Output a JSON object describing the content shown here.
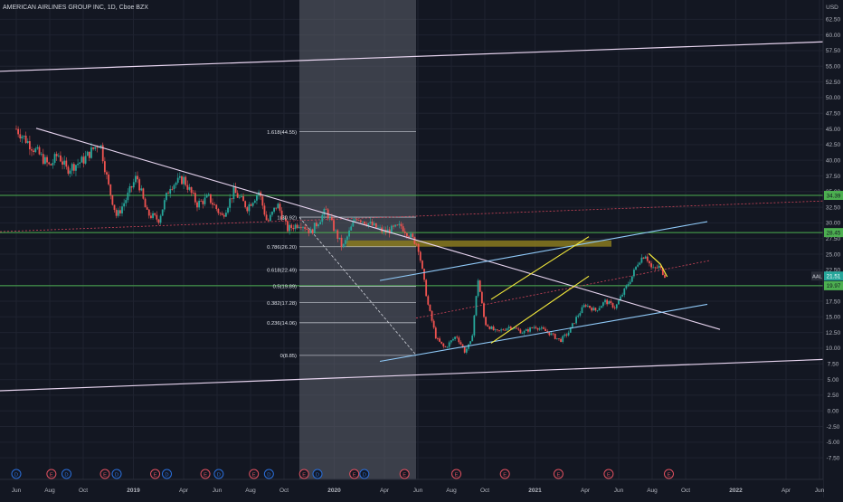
{
  "header": {
    "title": "AMERICAN AIRLINES GROUP INC, 1D, Cboe BZX"
  },
  "colors": {
    "background": "#131722",
    "grid": "#1f2330",
    "axis_text": "#b2b5be",
    "candle_up": "#26a69a",
    "candle_down": "#ef5350",
    "trendline": "#e8d5f0",
    "channel": "#90caf9",
    "wedge": "#f5eb3b",
    "support": "#4caf50",
    "fib_line": "#d1d4dc",
    "zone": "#8a7a1f"
  },
  "chart_data": {
    "type": "candlestick",
    "currency_label": "USD",
    "symbol": "AAL",
    "last_price": 21.51,
    "y_ticks": [
      62.5,
      60.0,
      57.5,
      55.0,
      52.5,
      50.0,
      47.5,
      45.0,
      42.5,
      40.0,
      37.5,
      35.0,
      32.5,
      30.0,
      27.5,
      25.0,
      22.5,
      20.0,
      17.5,
      15.0,
      12.5,
      10.0,
      7.5,
      5.0,
      2.5,
      0.0,
      -2.5,
      -5.0,
      -7.5
    ],
    "ylim": [
      -9.5,
      65
    ],
    "x_ticks": [
      "Jun",
      "Aug",
      "Oct",
      "2019",
      "Apr",
      "Jun",
      "Aug",
      "Oct",
      "2020",
      "Apr",
      "Jun",
      "Aug",
      "Oct",
      "2021",
      "Apr",
      "Jun",
      "Aug",
      "Oct",
      "2022",
      "Apr",
      "Jun"
    ],
    "price_badges": [
      {
        "label": "34.39",
        "value": 34.39
      },
      {
        "label": "28.45",
        "value": 28.45
      },
      {
        "label": "19.97",
        "value": 19.97
      }
    ],
    "fib_levels": [
      {
        "label": "1.618(44.55)",
        "value": 44.55
      },
      {
        "label": "1(30.92)",
        "value": 30.92
      },
      {
        "label": "0.786(26.20)",
        "value": 26.2
      },
      {
        "label": "0.618(22.49)",
        "value": 22.49
      },
      {
        "label": "0.5(19.89)",
        "value": 19.89
      },
      {
        "label": "0.382(17.28)",
        "value": 17.28
      },
      {
        "label": "0.236(14.06)",
        "value": 14.06
      },
      {
        "label": "0(8.85)",
        "value": 8.85
      }
    ],
    "support_levels": [
      34.39,
      28.45,
      19.97
    ],
    "resistance_zone": [
      26.2,
      27.2
    ],
    "events": [
      {
        "month": 0.0,
        "type": "D"
      },
      {
        "month": 2.1,
        "type": "E"
      },
      {
        "month": 3.0,
        "type": "D"
      },
      {
        "month": 5.3,
        "type": "E"
      },
      {
        "month": 6.0,
        "type": "D"
      },
      {
        "month": 8.3,
        "type": "E"
      },
      {
        "month": 9.0,
        "type": "D"
      },
      {
        "month": 11.3,
        "type": "E"
      },
      {
        "month": 12.1,
        "type": "D"
      },
      {
        "month": 14.2,
        "type": "E"
      },
      {
        "month": 15.1,
        "type": "D"
      },
      {
        "month": 17.2,
        "type": "E"
      },
      {
        "month": 18.0,
        "type": "D"
      },
      {
        "month": 20.2,
        "type": "E"
      },
      {
        "month": 20.8,
        "type": "D"
      },
      {
        "month": 23.2,
        "type": "E"
      },
      {
        "month": 26.3,
        "type": "E"
      },
      {
        "month": 29.2,
        "type": "E"
      },
      {
        "month": 32.4,
        "type": "E"
      },
      {
        "month": 35.4,
        "type": "E"
      },
      {
        "month": 39.0,
        "type": "E"
      }
    ],
    "price_path": [
      [
        0.0,
        45.0
      ],
      [
        1.0,
        42.0
      ],
      [
        2.0,
        39.0
      ],
      [
        2.5,
        41.0
      ],
      [
        3.0,
        38.5
      ],
      [
        4.0,
        40.0
      ],
      [
        5.0,
        43.0
      ],
      [
        5.5,
        36.0
      ],
      [
        6.0,
        31.0
      ],
      [
        6.6,
        34.0
      ],
      [
        7.2,
        37.5
      ],
      [
        7.8,
        31.5
      ],
      [
        8.5,
        30.5
      ],
      [
        9.2,
        36.0
      ],
      [
        10.0,
        37.0
      ],
      [
        10.8,
        33.0
      ],
      [
        11.5,
        34.0
      ],
      [
        12.3,
        31.0
      ],
      [
        13.0,
        35.0
      ],
      [
        13.8,
        32.5
      ],
      [
        14.5,
        35.0
      ],
      [
        15.0,
        30.0
      ],
      [
        15.6,
        33.0
      ],
      [
        16.2,
        29.0
      ],
      [
        17.0,
        30.0
      ],
      [
        17.6,
        28.5
      ],
      [
        18.5,
        32.0
      ],
      [
        19.5,
        26.0
      ],
      [
        20.3,
        31.0
      ],
      [
        21.0,
        30.0
      ],
      [
        22.0,
        28.5
      ],
      [
        23.0,
        29.5
      ],
      [
        23.5,
        28.0
      ],
      [
        24.0,
        26.5
      ],
      [
        24.6,
        17.0
      ],
      [
        25.1,
        11.5
      ],
      [
        25.6,
        10.0
      ],
      [
        26.3,
        12.0
      ],
      [
        26.8,
        9.5
      ],
      [
        27.2,
        11.0
      ],
      [
        27.6,
        21.0
      ],
      [
        28.0,
        14.0
      ],
      [
        28.7,
        12.5
      ],
      [
        29.5,
        13.5
      ],
      [
        30.3,
        12.5
      ],
      [
        31.0,
        13.5
      ],
      [
        31.8,
        12.5
      ],
      [
        32.5,
        11.2
      ],
      [
        33.0,
        12.5
      ],
      [
        33.5,
        15.0
      ],
      [
        34.0,
        17.0
      ],
      [
        34.6,
        16.0
      ],
      [
        35.2,
        17.5
      ],
      [
        35.8,
        16.5
      ],
      [
        36.3,
        19.0
      ],
      [
        36.8,
        21.5
      ],
      [
        37.2,
        24.0
      ],
      [
        37.6,
        25.0
      ],
      [
        38.0,
        22.5
      ],
      [
        38.4,
        23.0
      ],
      [
        38.8,
        21.51
      ]
    ]
  }
}
